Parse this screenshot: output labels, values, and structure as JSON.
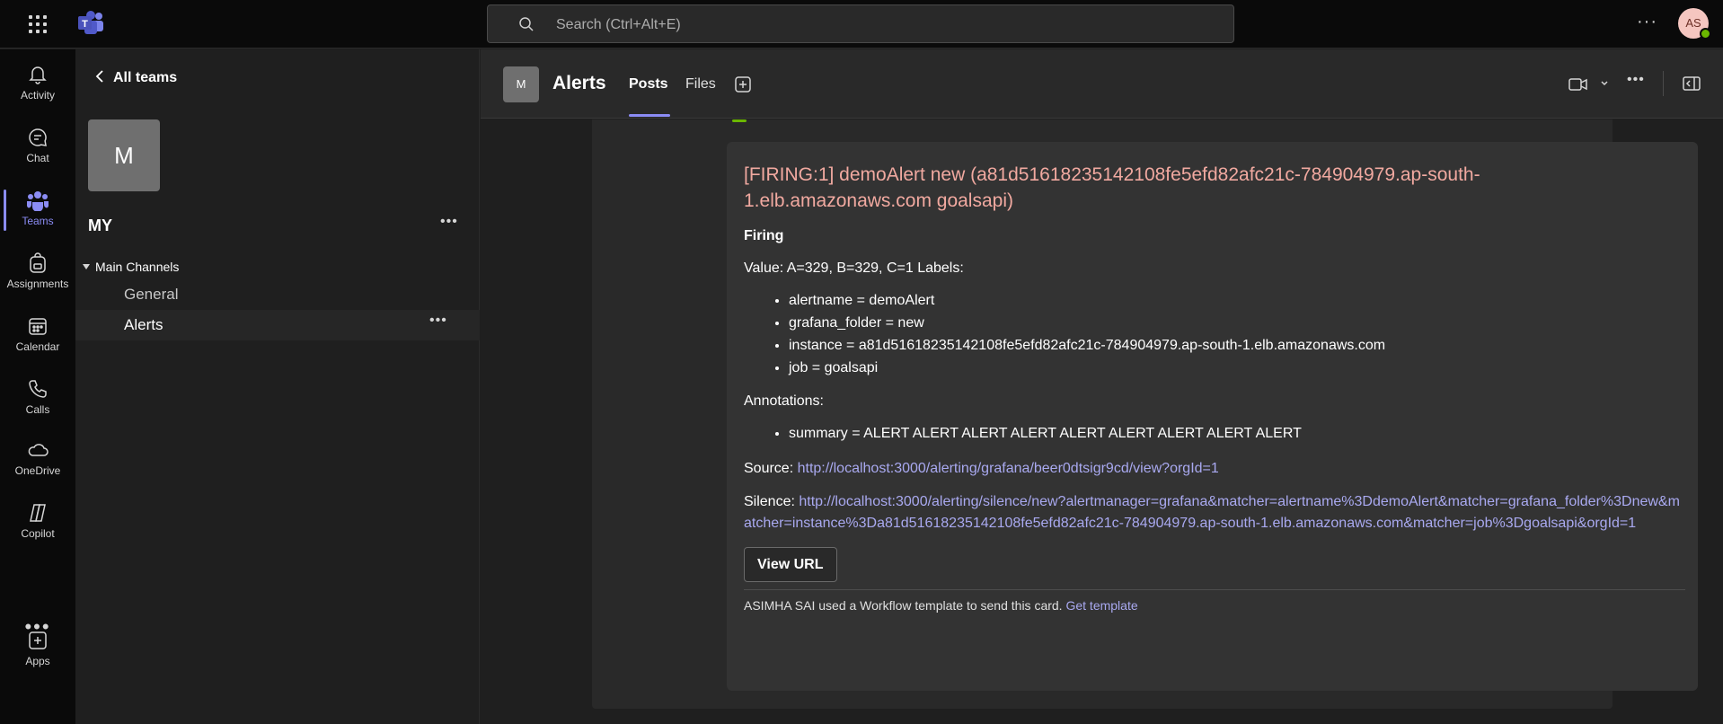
{
  "search": {
    "placeholder": "Search (Ctrl+Alt+E)"
  },
  "user": {
    "initials": "AS"
  },
  "rail": {
    "items": [
      {
        "label": "Activity",
        "icon": "bell-icon"
      },
      {
        "label": "Chat",
        "icon": "chat-icon"
      },
      {
        "label": "Teams",
        "icon": "teams-icon"
      },
      {
        "label": "Assignments",
        "icon": "backpack-icon"
      },
      {
        "label": "Calendar",
        "icon": "calendar-icon"
      },
      {
        "label": "Calls",
        "icon": "phone-icon"
      },
      {
        "label": "OneDrive",
        "icon": "cloud-icon"
      },
      {
        "label": "Copilot",
        "icon": "copilot-icon"
      },
      {
        "label": "Apps",
        "icon": "add-app-icon"
      }
    ],
    "more": "•••"
  },
  "panel": {
    "back_label": "All teams",
    "team_initial": "M",
    "team_name": "MY",
    "more": "•••",
    "section_label": "Main Channels",
    "channels": [
      {
        "label": "General"
      },
      {
        "label": "Alerts"
      }
    ]
  },
  "header": {
    "avatar_initial": "M",
    "title": "Alerts",
    "tabs": [
      {
        "label": "Posts"
      },
      {
        "label": "Files"
      }
    ],
    "more": "•••"
  },
  "card": {
    "title": "[FIRING:1] demoAlert new (a81d51618235142108fe5efd82afc21c-784904979.ap-south-1.elb.amazonaws.com goalsapi)",
    "status": "Firing",
    "value_line": "Value: A=329, B=329, C=1 Labels:",
    "labels": [
      "alertname = demoAlert",
      "grafana_folder = new",
      "instance = a81d51618235142108fe5efd82afc21c-784904979.ap-south-1.elb.amazonaws.com",
      "job = goalsapi"
    ],
    "annotations_label": "Annotations:",
    "annotations": [
      "summary = ALERT ALERT ALERT ALERT ALERT ALERT ALERT ALERT ALERT"
    ],
    "source_label": "Source:",
    "source_url": "http://localhost:3000/alerting/grafana/beer0dtsigr9cd/view?orgId=1",
    "silence_label": "Silence:",
    "silence_url": "http://localhost:3000/alerting/silence/new?alertmanager=grafana&matcher=alertname%3DdemoAlert&matcher=grafana_folder%3Dnew&matcher=instance%3Da81d51618235142108fe5efd82afc21c-784904979.ap-south-1.elb.amazonaws.com&matcher=job%3Dgoalsapi&orgId=1",
    "button_label": "View URL",
    "footer_text": "ASIMHA SAI used a Workflow template to send this card.",
    "footer_link": "Get template"
  },
  "colors": {
    "accent": "#8b8cf4",
    "alert_title": "#f1a9a0",
    "link": "#a9a9f0",
    "presence": "#6bb700"
  }
}
